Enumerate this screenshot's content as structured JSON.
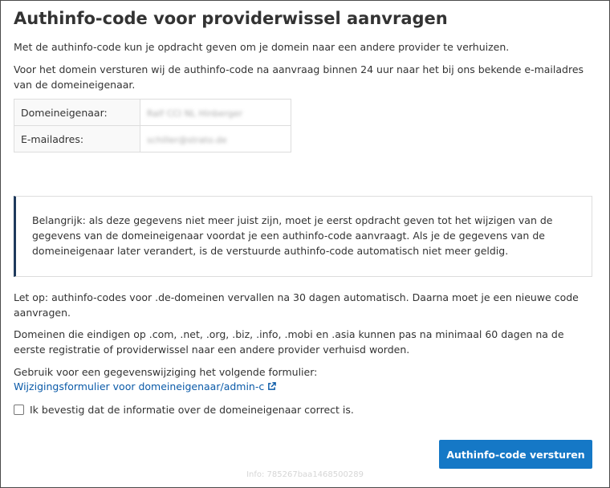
{
  "title": "Authinfo-code voor providerwissel aanvragen",
  "intro": "Met de authinfo-code kun je opdracht geven om je domein naar een andere provider te verhuizen.",
  "send_info": "Voor het domein versturen wij de authinfo-code na aanvraag binnen 24 uur naar het bij ons bekende e-mailadres van de domeineigenaar.",
  "owner_table": {
    "rows": [
      {
        "label": "Domeineigenaar:",
        "value": "Ralf CCI NL Hinberger"
      },
      {
        "label": "E-mailadres:",
        "value": "schiller@strato.de"
      }
    ]
  },
  "notice": "Belangrijk: als deze gegevens niet meer juist zijn, moet je eerst opdracht geven tot het wijzigen van de gegevens van de domeineigenaar voordat je een authinfo-code aanvraagt. Als je de gegevens van de domeineigenaar later verandert, is de verstuurde authinfo-code automatisch niet meer geldig.",
  "expiry_note": "Let op: authinfo-codes voor .de-domeinen vervallen na 30 dagen automatisch. Daarna moet je een nieuwe code aanvragen.",
  "domains_note": "Domeinen die eindigen op .com, .net, .org, .biz, .info, .mobi en .asia kunnen pas na minimaal 60 dagen na de eerste registratie of providerwissel naar een andere provider verhuisd worden.",
  "form_hint": "Gebruik voor een gegevenswijziging het volgende formulier:",
  "form_link": "Wijzigingsformulier voor domeineigenaar/admin-c",
  "confirm_label": "Ik bevestig dat de informatie over de domeineigenaar correct is.",
  "confirm_checked": false,
  "submit_label": "Authinfo-code versturen",
  "footer_info": "Info: 785267baa1468500289",
  "colors": {
    "accent": "#1578c6",
    "link": "#0a5aa8",
    "notice_border": "#1f3a5c"
  },
  "icons": {
    "link": "external-link-icon"
  }
}
